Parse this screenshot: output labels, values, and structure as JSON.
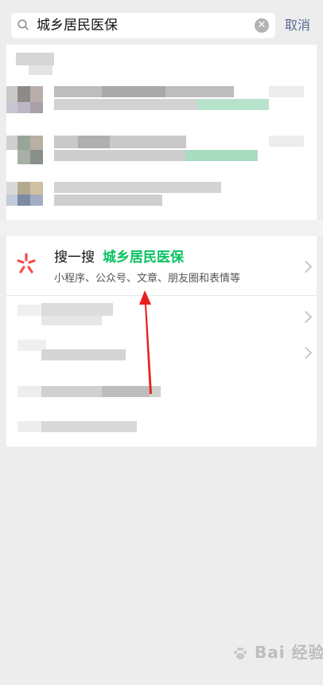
{
  "search": {
    "query": "城乡居民医保",
    "cancel_label": "取消"
  },
  "souyisou": {
    "label": "搜一搜",
    "keyword": "城乡居民医保",
    "subtitle": "小程序、公众号、文章、朋友圈和表情等"
  },
  "watermark": {
    "text": "Bai 经验"
  },
  "colors": {
    "accent_green": "#07c160",
    "link_blue": "#576b95",
    "arrow_red": "#e8201a"
  },
  "icons": {
    "search": "search-icon",
    "clear": "clear-icon",
    "souyisou": "souyisou-logo-icon",
    "chevron": "chevron-right-icon"
  }
}
